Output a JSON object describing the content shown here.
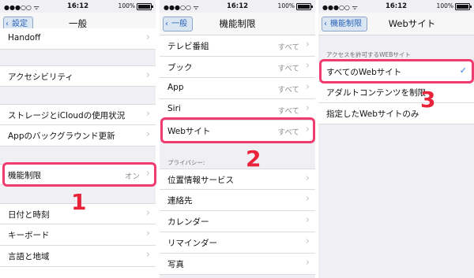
{
  "status": {
    "time": "16:12",
    "battery": "100%"
  },
  "panel1": {
    "back": "設定",
    "title": "一般",
    "rows": [
      {
        "label": "Handoff",
        "value": ""
      },
      {
        "label": "アクセシビリティ",
        "value": ""
      },
      {
        "label": "ストレージとiCloudの使用状況",
        "value": ""
      },
      {
        "label": "Appのバックグラウンド更新",
        "value": ""
      },
      {
        "label": "機能制限",
        "value": "オン"
      },
      {
        "label": "日付と時刻",
        "value": ""
      },
      {
        "label": "キーボード",
        "value": ""
      },
      {
        "label": "言語と地域",
        "value": ""
      }
    ],
    "step": "1"
  },
  "panel2": {
    "back": "一般",
    "title": "機能制限",
    "rows": [
      {
        "label": "テレビ番組",
        "value": "すべて"
      },
      {
        "label": "ブック",
        "value": "すべて"
      },
      {
        "label": "App",
        "value": "すべて"
      },
      {
        "label": "Siri",
        "value": "すべて"
      },
      {
        "label": "Webサイト",
        "value": "すべて"
      }
    ],
    "privacy_header": "プライバシー:",
    "privacy_rows": [
      {
        "label": "位置情報サービス"
      },
      {
        "label": "連絡先"
      },
      {
        "label": "カレンダー"
      },
      {
        "label": "リマインダー"
      },
      {
        "label": "写真"
      }
    ],
    "step": "2"
  },
  "panel3": {
    "back": "機能制限",
    "title": "Webサイト",
    "section_header": "アクセスを許可するWEBサイト",
    "options": [
      {
        "label": "すべてのWebサイト",
        "checked": true
      },
      {
        "label": "アダルトコンテンツを制限",
        "checked": false
      },
      {
        "label": "指定したWebサイトのみ",
        "checked": false
      }
    ],
    "step": "3"
  }
}
